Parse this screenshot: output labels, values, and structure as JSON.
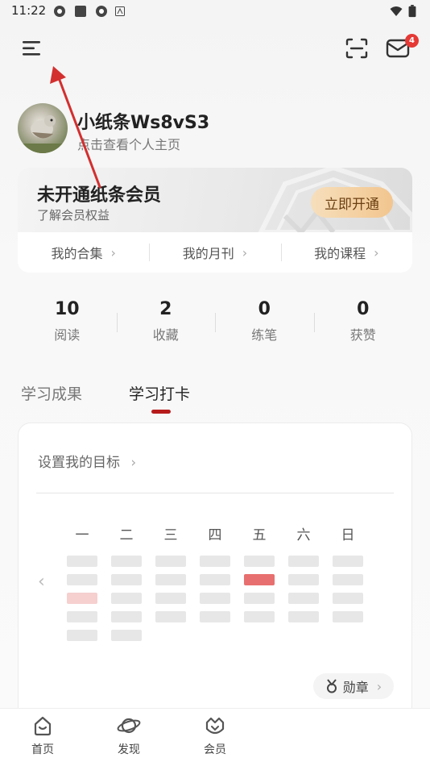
{
  "status_bar": {
    "time": "11:22"
  },
  "header": {
    "notification_count": "4"
  },
  "profile": {
    "name": "小纸条Ws8vS3",
    "subtitle": "点击查看个人主页"
  },
  "member": {
    "title": "未开通纸条会员",
    "subtitle": "了解会员权益",
    "open_button": "立即开通",
    "links": [
      "我的合集",
      "我的月刊",
      "我的课程"
    ]
  },
  "stats": [
    {
      "value": "10",
      "label": "阅读"
    },
    {
      "value": "2",
      "label": "收藏"
    },
    {
      "value": "0",
      "label": "练笔"
    },
    {
      "value": "0",
      "label": "获赞"
    }
  ],
  "tabs": {
    "inactive": "学习成果",
    "active": "学习打卡"
  },
  "checkin": {
    "goal": "设置我的目标",
    "weekdays": [
      "一",
      "二",
      "三",
      "四",
      "五",
      "六",
      "日"
    ],
    "medal_button": "勋章"
  },
  "bottom_nav": [
    "首页",
    "发现",
    "会员"
  ],
  "colors": {
    "accent_red": "#b71c1c",
    "checkin_red": "#e86f6f",
    "checkin_pink": "#f6cfcf",
    "vip_gold": "#f2c58e"
  }
}
